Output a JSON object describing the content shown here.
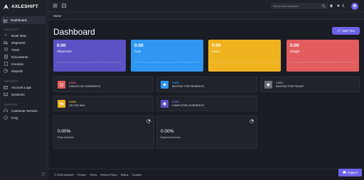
{
  "brand": {
    "name": "AXLESHIFT"
  },
  "sidebar": {
    "active": {
      "label": "Dashboard",
      "icon": "chart-icon"
    },
    "sections": [
      {
        "title": "SERVICES",
        "items": [
          {
            "label": "Book New",
            "icon": "plus-icon"
          },
          {
            "label": "Shipment",
            "icon": "truck-icon"
          },
          {
            "label": "Track",
            "icon": "pin-icon"
          },
          {
            "label": "Documents",
            "icon": "document-icon"
          },
          {
            "label": "Invoices",
            "icon": "invoice-icon"
          },
          {
            "label": "Reports",
            "icon": "reports-icon"
          }
        ]
      },
      {
        "title": "SECURITY",
        "items": [
          {
            "label": "Account Logs",
            "icon": "logs-icon"
          },
          {
            "label": "Sessions",
            "icon": "sessions-icon"
          }
        ]
      },
      {
        "title": "SUPPORT",
        "items": [
          {
            "label": "Customer Service",
            "icon": "headset-icon"
          },
          {
            "label": "FAQ",
            "icon": "faq-icon"
          }
        ]
      }
    ]
  },
  "topbar": {
    "search_placeholder": "Find & track shipment...",
    "avatar_initial": "M"
  },
  "breadcrumb": "Home",
  "page_title": "Dashboard",
  "start_tour": "Start Tour",
  "stats": [
    {
      "value": "0.00",
      "label": "Shipments",
      "color": "#5b52c5"
    },
    {
      "value": "0.00",
      "label": "Cost",
      "color": "#2f97f2"
    },
    {
      "value": "0.00",
      "label": "Items",
      "color": "#f0b320"
    },
    {
      "value": "0.00",
      "label": "Weight",
      "color": "#e35d5f"
    }
  ],
  "info_cards": [
    {
      "pct": "0.00%",
      "label": "CANCELLED SHIPMENTS",
      "icon_color": "#e35d5f",
      "pct_color": "#e35d5f",
      "icon": "cancel-icon"
    },
    {
      "pct": "0.00%",
      "label": "WAITING FOR PAYMENTS",
      "icon_color": "#2f97f2",
      "pct_color": "#2f97f2",
      "icon": "payment-icon"
    },
    {
      "pct": "0.00%",
      "label": "WAITING FOR PICKUP",
      "icon_color": "#6b6f7a",
      "pct_color": "#9aa0ab",
      "icon": "pickup-icon"
    },
    {
      "pct": "0.00%",
      "label": "ON THE WAY",
      "icon_color": "#f0b320",
      "pct_color": "#f0b320",
      "icon": "truck-icon"
    },
    {
      "pct": "0.00%",
      "label": "COMPLETED SHIPMENTS",
      "icon_color": "#5b52c5",
      "pct_color": "#7f77e8",
      "icon": "check-icon"
    }
  ],
  "invoices": [
    {
      "value": "0.00%",
      "label": "Paid Invoices"
    },
    {
      "value": "0.00%",
      "label": "Expired Invoices"
    }
  ],
  "footer": {
    "copyright": "© 2025 Axleshift",
    "links": [
      "Privacy",
      "Terms",
      "Refund Policy",
      "Status",
      "Cookies"
    ]
  },
  "support_label": "Support"
}
